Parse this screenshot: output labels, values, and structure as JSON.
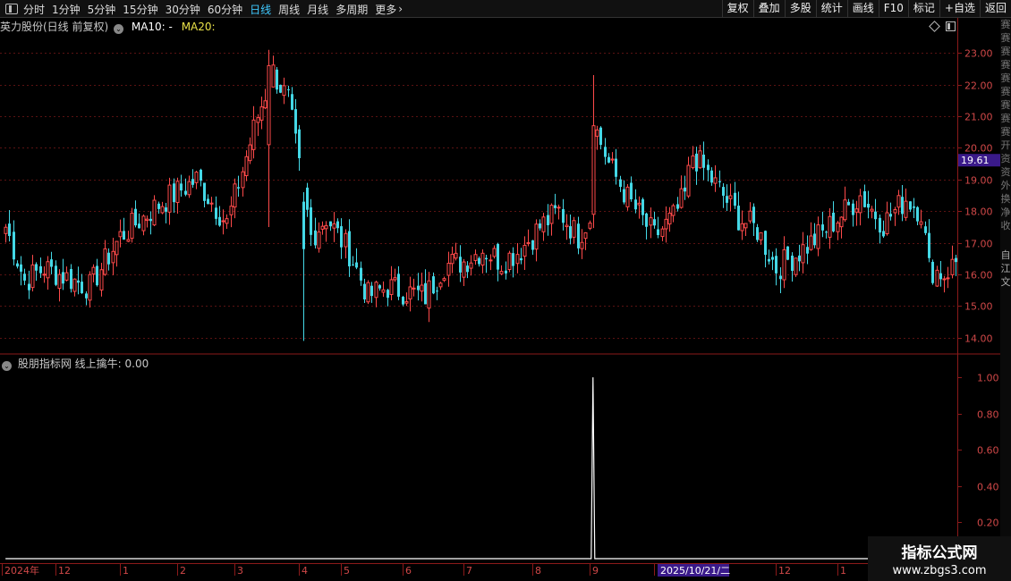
{
  "toolbar": {
    "periods": [
      "分时",
      "1分钟",
      "5分钟",
      "15分钟",
      "30分钟",
      "60分钟",
      "日线",
      "周线",
      "月线",
      "多周期",
      "更多"
    ],
    "active_period": "日线",
    "more_arrow": "›",
    "right_buttons": [
      "复权",
      "叠加",
      "多股",
      "统计",
      "画线",
      "F10",
      "标记",
      "+自选",
      "返回"
    ]
  },
  "main_panel": {
    "title": "英力股份(日线 前复权)",
    "ma10_label": "MA10: -",
    "ma20_label": "MA20:",
    "price_tag": "19.61",
    "up_color": "#ff4a4a",
    "down_color": "#44d8e6",
    "ma20_color": "#e8e048"
  },
  "indicator_panel": {
    "title": "股朋指标网 线上擒牛: 0.00"
  },
  "right_strip_chars": "赛赛赛赛赛赛赛赛赛开资资外换净收",
  "right_strip_chars2": "自江文",
  "watermark": {
    "line1": "指标公式网",
    "line2": "www.zbgs3.com"
  },
  "date_axis": {
    "labels": [
      "2024年",
      "12",
      "1",
      "2",
      "3",
      "4",
      "5",
      "6",
      "7",
      "8",
      "9",
      "10",
      "11",
      "12",
      "1",
      "2"
    ],
    "highlight": "2025/10/21/二"
  },
  "chart_data": [
    {
      "type": "candlestick",
      "title": "英力股份(日线 前复权)",
      "y_ticks": [
        23.0,
        22.0,
        21.0,
        20.0,
        19.0,
        18.0,
        17.0,
        16.0,
        15.0,
        14.0
      ],
      "ylim": [
        13.6,
        23.6
      ],
      "n_bars": 250,
      "current_price": 19.61,
      "grid": true,
      "keypoints": [
        [
          0,
          17.5
        ],
        [
          5,
          15.8
        ],
        [
          10,
          16.2
        ],
        [
          16,
          15.9
        ],
        [
          22,
          15.6
        ],
        [
          30,
          17.2
        ],
        [
          40,
          18.2
        ],
        [
          50,
          19.0
        ],
        [
          58,
          17.6
        ],
        [
          66,
          21.0
        ],
        [
          70,
          22.4
        ],
        [
          74,
          21.5
        ],
        [
          80,
          17.2
        ],
        [
          84,
          17.8
        ],
        [
          90,
          16.7
        ],
        [
          95,
          15.3
        ],
        [
          100,
          15.6
        ],
        [
          110,
          15.3
        ],
        [
          115,
          16.3
        ],
        [
          120,
          16.4
        ],
        [
          125,
          16.8
        ],
        [
          130,
          16.4
        ],
        [
          135,
          16.8
        ],
        [
          140,
          17.5
        ],
        [
          145,
          18.0
        ],
        [
          150,
          17.2
        ],
        [
          153,
          17.8
        ],
        [
          154,
          20.8
        ],
        [
          158,
          19.5
        ],
        [
          163,
          18.4
        ],
        [
          170,
          17.2
        ],
        [
          175,
          17.8
        ],
        [
          178,
          18.5
        ],
        [
          180,
          19.8
        ],
        [
          185,
          19.0
        ],
        [
          192,
          17.8
        ],
        [
          197,
          17.4
        ],
        [
          202,
          16.2
        ],
        [
          208,
          16.7
        ],
        [
          214,
          17.3
        ],
        [
          220,
          18.0
        ],
        [
          224,
          18.5
        ],
        [
          230,
          17.6
        ],
        [
          236,
          18.4
        ],
        [
          240,
          18.0
        ],
        [
          242,
          16.2
        ],
        [
          246,
          16.0
        ],
        [
          249,
          16.4
        ]
      ],
      "spikes": [
        [
          69,
          23.1,
          17.5
        ],
        [
          78,
          17.7,
          13.9
        ],
        [
          154,
          22.3,
          17.8
        ]
      ]
    },
    {
      "type": "line",
      "title": "股朋指标网 线上擒牛: 0.00",
      "y_ticks": [
        1.0,
        0.8,
        0.6,
        0.4,
        0.2
      ],
      "ylim": [
        0,
        1.05
      ],
      "n_bars": 250,
      "signal_index": 154,
      "signal_value": 1.0
    }
  ]
}
